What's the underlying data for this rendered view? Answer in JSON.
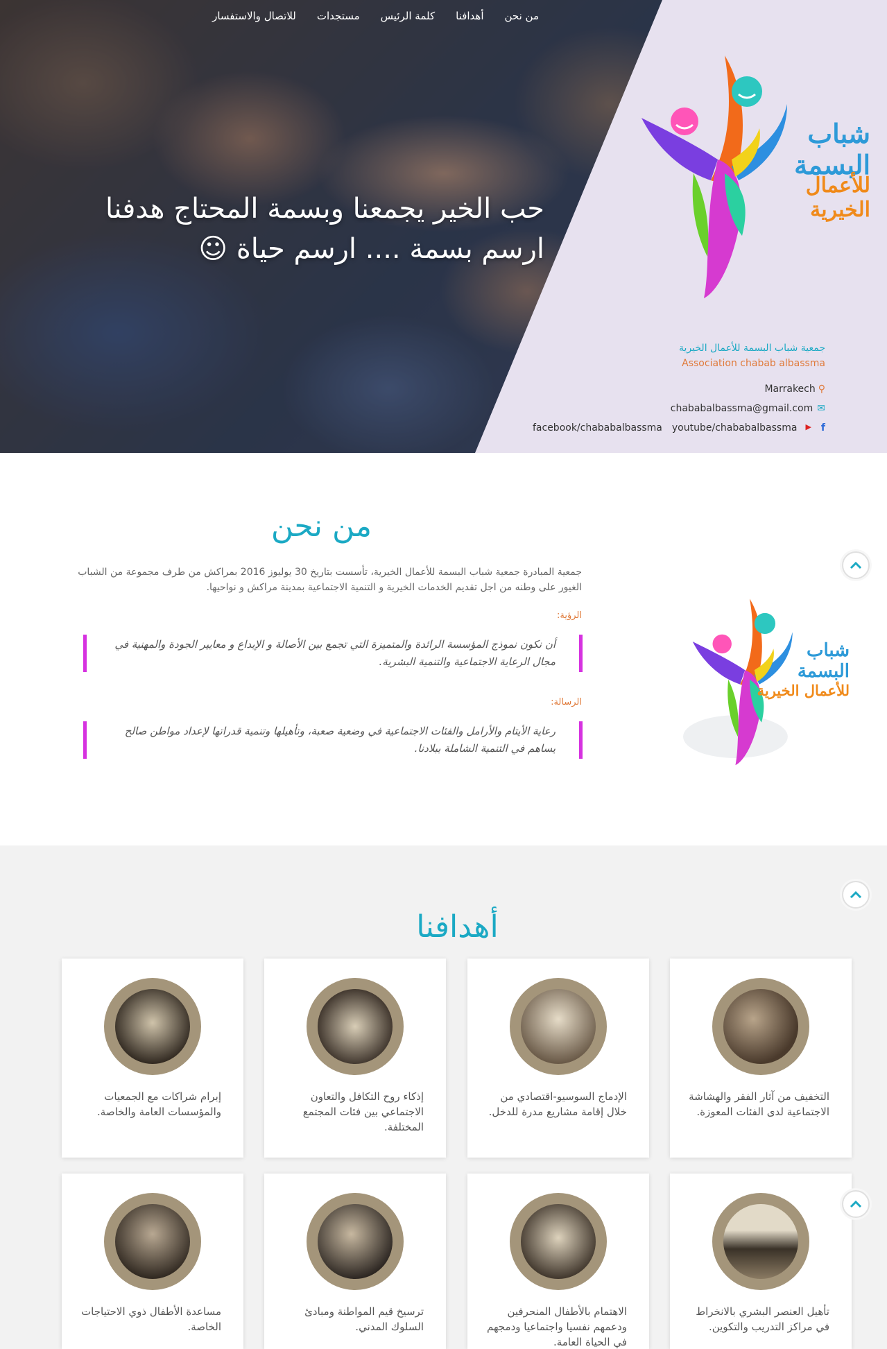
{
  "nav": {
    "items": [
      "من نحن",
      "أهدافنا",
      "كلمة الرئيس",
      "مستجدات",
      "للاتصال والاستفسار"
    ]
  },
  "hero": {
    "line1": "حب الخير يجمعنا وبسمة المحتاج هدفنا",
    "line2": "ارسم بسمة .... ارسم حياة ☺"
  },
  "logo": {
    "text1": "شباب البسمة",
    "text2": "للأعمال الخيرية"
  },
  "org": {
    "name_ar": "جمعية شباب البسمة للأعمال الخيرية",
    "name_en": "Association chabab albassma",
    "city": "Marrakech",
    "email": "chababalbassma@gmail.com",
    "youtube": "youtube/chababalbassma",
    "facebook": "facebook/chababalbassma"
  },
  "about": {
    "title": "من نحن",
    "text": "جمعية المبادرة جمعية شباب البسمة للأعمال الخيرية، تأسست بتاريخ 30 يوليوز 2016 بمراكش من طرف مجموعة من الشباب الغيور على وطنه من اجل تقديم الخدمات الخيرية و التنمية الاجتماعية بمدينة مراكش و نواحيها.",
    "vision_label": "الرؤية:",
    "vision": "أن نكون نموذج المؤسسة الرائدة والمتميزة التي تجمع بين الأصالة و الإبداع و معايير الجودة والمهنية في مجال الرعاية الاجتماعية والتنمية البشرية.",
    "mission_label": "الرسالة:",
    "mission": "رعاية الأيتام والأرامل والفئات الاجتماعية في وضعية صعبة، وتأهيلها وتنمية قدراتها لإعداد مواطن صالح يساهم في التنمية الشاملة ببلادنا."
  },
  "goals": {
    "title": "أهدافنا",
    "items": [
      "التخفيف من آثار الفقر والهشاشة الاجتماعية لدى الفئات المعوزة.",
      "الإدماج السوسيو-اقتصادي من خلال إقامة مشاريع مدرة للدخل.",
      "إذكاء روح التكافل والتعاون الاجتماعي بين فئات المجتمع المختلفة.",
      "إبرام شراكات مع الجمعيات والمؤسسات العامة والخاصة.",
      "تأهيل العنصر البشري بالانخراط في مراكز التدريب والتكوين.",
      "الاهتمام بالأطفال المنحرفين ودعمهم نفسيا واجتماعيا ودمجهم في الحياة العامة.",
      "ترسيخ قيم المواطنة ومبادئ السلوك المدني.",
      "مساعدة الأطفال ذوي الاحتياجات الخاصة."
    ]
  },
  "colors": {
    "accent": "#1ba9c4",
    "orange": "#e07a3a",
    "magenta": "#d632e0",
    "goal_ring": "#a4957a"
  }
}
